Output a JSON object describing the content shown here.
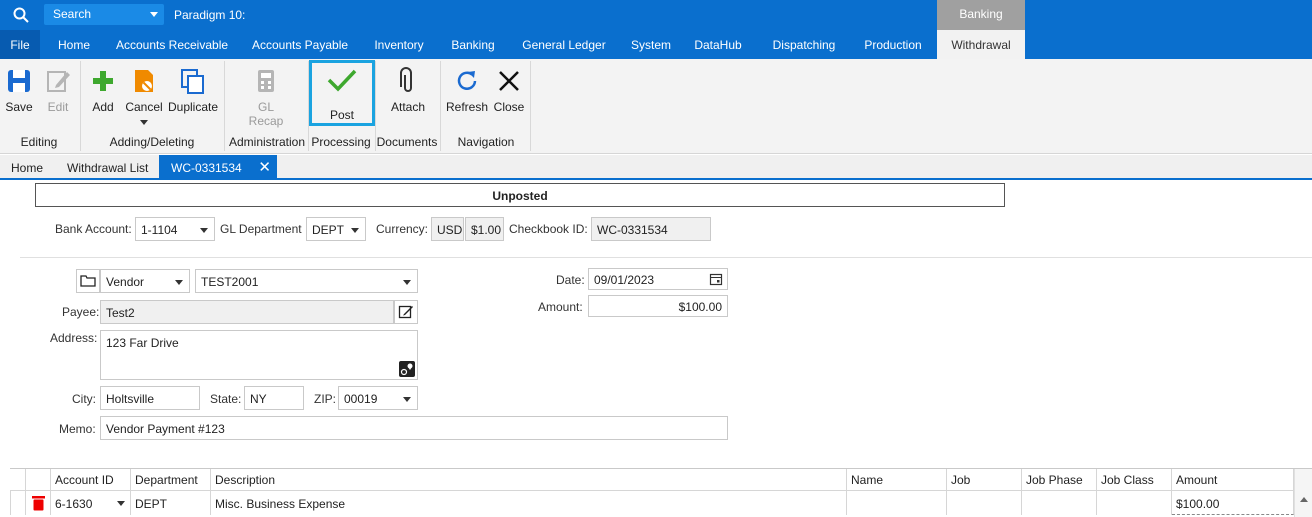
{
  "topbar": {
    "search_placeholder": "Search",
    "app_title": "Paradigm 10:",
    "context_tab": "Banking"
  },
  "menu": [
    "File",
    "Home",
    "Accounts Receivable",
    "Accounts Payable",
    "Inventory",
    "Banking",
    "General Ledger",
    "System",
    "DataHub",
    "Dispatching",
    "Production",
    "Withdrawal"
  ],
  "ribbon": {
    "save": "Save",
    "edit": "Edit",
    "editing_group": "Editing",
    "add": "Add",
    "cancel": "Cancel",
    "duplicate": "Duplicate",
    "adding_group": "Adding/Deleting",
    "gl": "GL",
    "recap": "Recap",
    "admin_group": "Administration",
    "post": "Post",
    "processing_group": "Processing",
    "attach": "Attach",
    "documents_group": "Documents",
    "refresh": "Refresh",
    "close": "Close",
    "navigation_group": "Navigation"
  },
  "doc_tabs": {
    "home": "Home",
    "withdrawal_list": "Withdrawal List",
    "current": "WC-0331534"
  },
  "status": "Unposted",
  "header": {
    "bank_account_label": "Bank Account:",
    "bank_account": "1-1104",
    "gl_dept_label": "GL Department",
    "gl_dept": "DEPT",
    "currency_label": "Currency:",
    "currency": "USD",
    "rate": "$1.00",
    "checkbook_label": "Checkbook ID:",
    "checkbook": "WC-0331534"
  },
  "payee": {
    "type": "Vendor",
    "vendor_id": "TEST2001",
    "payee_label": "Payee:",
    "payee": "Test2",
    "address_label": "Address:",
    "address": "123 Far Drive",
    "city_label": "City:",
    "city": "Holtsville",
    "state_label": "State:",
    "state": "NY",
    "zip_label": "ZIP:",
    "zip": "00019",
    "memo_label": "Memo:",
    "memo": "Vendor Payment #123",
    "date_label": "Date:",
    "date": "09/01/2023",
    "amount_label": "Amount:",
    "amount": "$100.00"
  },
  "grid": {
    "headers": {
      "account": "Account ID",
      "department": "Department",
      "description": "Description",
      "name": "Name",
      "job": "Job",
      "job_phase": "Job Phase",
      "job_class": "Job Class",
      "amount": "Amount"
    },
    "row": {
      "account": "6-1630",
      "department": "DEPT",
      "description": "Misc. Business Expense",
      "amount": "$100.00"
    }
  },
  "colors": {
    "brand": "#0a6fce",
    "accent": "#1aa3e0",
    "context_tab": "#a0a0a0"
  }
}
